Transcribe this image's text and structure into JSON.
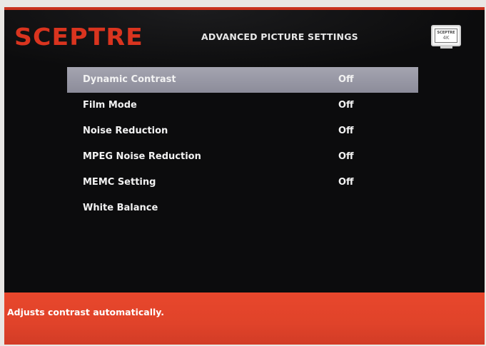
{
  "header": {
    "brand": "SCEPTRE",
    "title": "ADVANCED PICTURE SETTINGS",
    "badge": {
      "brand": "SCEPTRE",
      "resolution": "4K"
    }
  },
  "menu": {
    "items": [
      {
        "label": "Dynamic Contrast",
        "value": "Off",
        "selected": true
      },
      {
        "label": "Film Mode",
        "value": "Off"
      },
      {
        "label": "Noise Reduction",
        "value": "Off"
      },
      {
        "label": "MPEG Noise Reduction",
        "value": "Off"
      },
      {
        "label": "MEMC Setting",
        "value": "Off"
      },
      {
        "label": "White Balance",
        "value": ""
      }
    ]
  },
  "footer": {
    "help_text": "Adjusts contrast automatically."
  },
  "colors": {
    "brand": "#d9341f",
    "selection": "#9a9aa6",
    "footer": "#e0432a"
  }
}
